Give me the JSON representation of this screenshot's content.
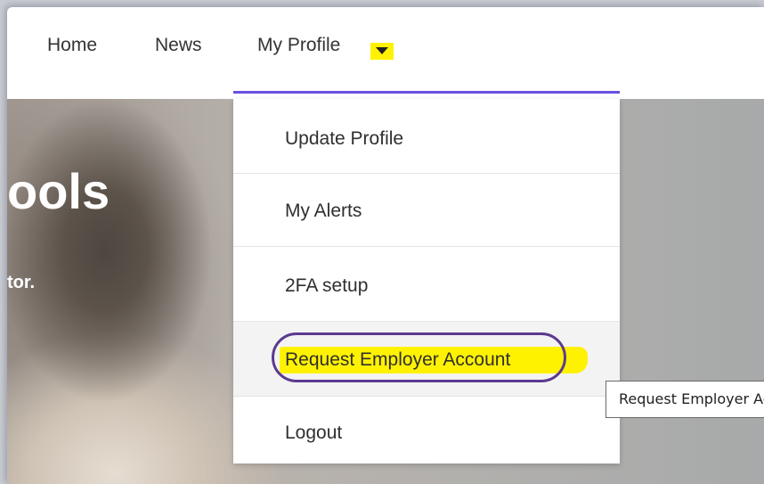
{
  "nav": {
    "items": [
      {
        "label": "Home"
      },
      {
        "label": "News"
      },
      {
        "label": "My Profile"
      }
    ],
    "accent_color": "#6a4fe0",
    "caret_icon": "caret-down-icon"
  },
  "hero": {
    "title": "ools",
    "subtitle": "tor."
  },
  "dropdown": {
    "items": [
      {
        "label": "Update Profile"
      },
      {
        "label": "My Alerts"
      },
      {
        "label": "2FA setup"
      },
      {
        "label": "Request Employer Account",
        "hovered": true
      },
      {
        "label": "Logout"
      }
    ]
  },
  "annotations": {
    "highlight_color": "#fff200",
    "circle_color": "#5b3a8f"
  },
  "tooltip": {
    "text": "Request Employer Account"
  }
}
